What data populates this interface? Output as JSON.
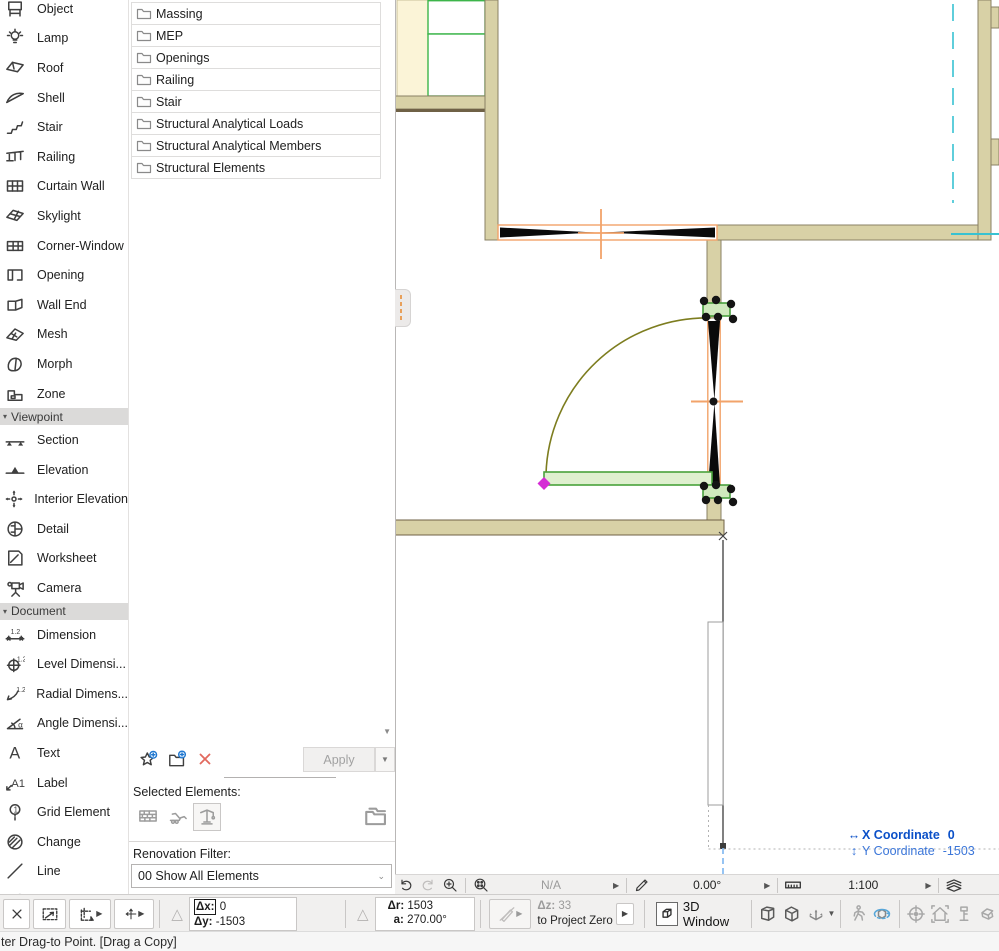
{
  "app": {
    "statusbar_message": "ter Drag-to Point. [Drag a Copy]"
  },
  "toolbox": {
    "rows": [
      {
        "type": "tool",
        "label": "Object",
        "icon": "object-icon"
      },
      {
        "type": "tool",
        "label": "Lamp",
        "icon": "lamp-icon"
      },
      {
        "type": "tool",
        "label": "Roof",
        "icon": "roof-icon"
      },
      {
        "type": "tool",
        "label": "Shell",
        "icon": "shell-icon"
      },
      {
        "type": "tool",
        "label": "Stair",
        "icon": "stair-icon"
      },
      {
        "type": "tool",
        "label": "Railing",
        "icon": "railing-icon"
      },
      {
        "type": "tool",
        "label": "Curtain Wall",
        "icon": "curtain-wall-icon"
      },
      {
        "type": "tool",
        "label": "Skylight",
        "icon": "skylight-icon"
      },
      {
        "type": "tool",
        "label": "Corner-Window",
        "icon": "corner-window-icon"
      },
      {
        "type": "tool",
        "label": "Opening",
        "icon": "opening-icon"
      },
      {
        "type": "tool",
        "label": "Wall End",
        "icon": "wall-end-icon"
      },
      {
        "type": "tool",
        "label": "Mesh",
        "icon": "mesh-icon"
      },
      {
        "type": "tool",
        "label": "Morph",
        "icon": "morph-icon"
      },
      {
        "type": "tool",
        "label": "Zone",
        "icon": "zone-icon"
      },
      {
        "type": "header",
        "label": "Viewpoint"
      },
      {
        "type": "tool",
        "label": "Section",
        "icon": "section-icon"
      },
      {
        "type": "tool",
        "label": "Elevation",
        "icon": "elevation-icon"
      },
      {
        "type": "tool",
        "label": "Interior Elevation",
        "icon": "interior-elevation-icon"
      },
      {
        "type": "tool",
        "label": "Detail",
        "icon": "detail-icon"
      },
      {
        "type": "tool",
        "label": "Worksheet",
        "icon": "worksheet-icon"
      },
      {
        "type": "tool",
        "label": "Camera",
        "icon": "camera-icon"
      },
      {
        "type": "header",
        "label": "Document"
      },
      {
        "type": "tool",
        "label": "Dimension",
        "icon": "dimension-icon"
      },
      {
        "type": "tool",
        "label": "Level Dimensi...",
        "icon": "level-dimension-icon"
      },
      {
        "type": "tool",
        "label": "Radial Dimens...",
        "icon": "radial-dimension-icon"
      },
      {
        "type": "tool",
        "label": "Angle Dimensi...",
        "icon": "angle-dimension-icon"
      },
      {
        "type": "tool",
        "label": "Text",
        "icon": "text-icon"
      },
      {
        "type": "tool",
        "label": "Label",
        "icon": "label-icon"
      },
      {
        "type": "tool",
        "label": "Grid Element",
        "icon": "grid-element-icon"
      },
      {
        "type": "tool",
        "label": "Change",
        "icon": "change-icon"
      },
      {
        "type": "tool",
        "label": "Line",
        "icon": "line-icon"
      },
      {
        "type": "tool",
        "label": "",
        "icon": "arc-icon"
      }
    ]
  },
  "library_panel": {
    "folders": [
      "Massing",
      "MEP",
      "Openings",
      "Railing",
      "Stair",
      "Structural Analytical Loads",
      "Structural Analytical Members",
      "Structural Elements"
    ],
    "apply_label": "Apply",
    "selected_elements_label": "Selected Elements:",
    "renovation_filter_label": "Renovation Filter:",
    "renovation_filter_value": "00 Show All Elements"
  },
  "quick_options": {
    "view_value": "N/A",
    "rotation_value": "0.00°",
    "scale_value": "1:100"
  },
  "tracker": {
    "x_icon": "↔",
    "x_label": "X Coordinate",
    "x_value": "0",
    "y_icon": "↕",
    "y_label": "Y Coordinate",
    "y_value": "-1503"
  },
  "coordinate_box": {
    "dx_label": "Δx:",
    "dx_value": "0",
    "dy_label": "Δy:",
    "dy_value": "-1503",
    "dr_label": "Δr:",
    "dr_value": "1503",
    "angle_label": "a:",
    "angle_value": "270.00°",
    "dz_label": "Δz:",
    "dz_value": "33",
    "reference_label": "to Project Zero"
  },
  "bottom_bar": {
    "threed_window_label": "3D Window"
  },
  "colors": {
    "wall_fill": "#d8d1a6",
    "selection_green": "#49a23b",
    "highlight_orange": "#f2a36a",
    "guide_cyan": "#38c2d2",
    "hotspot_magenta": "#d52bd5",
    "tracker_blue": "#0b50c8"
  }
}
